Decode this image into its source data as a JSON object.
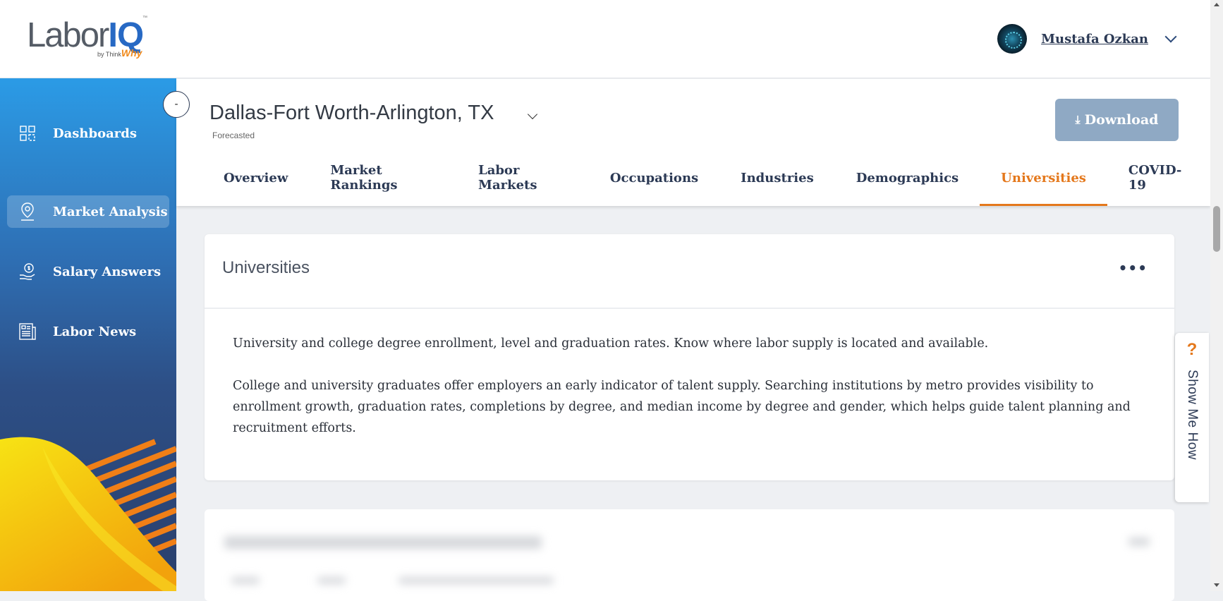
{
  "brand": {
    "logo_main": "Labor",
    "logo_iq": "IQ",
    "logo_by": "by Think",
    "logo_why": "Why",
    "logo_tm": "™"
  },
  "user": {
    "name": "Mustafa Ozkan"
  },
  "sidebar": {
    "collapse_label": "-",
    "items": [
      {
        "label": "Dashboards",
        "icon": "grid-icon",
        "active": false
      },
      {
        "label": "Market Analysis",
        "icon": "location-pin-icon",
        "active": true
      },
      {
        "label": "Salary Answers",
        "icon": "money-hand-icon",
        "active": false
      },
      {
        "label": "Labor News",
        "icon": "newspaper-icon",
        "active": false
      }
    ]
  },
  "header": {
    "location": "Dallas-Fort Worth-Arlington, TX",
    "subtitle": "Forecasted",
    "download_label": "Download",
    "tabs": [
      {
        "label": "Overview",
        "active": false
      },
      {
        "label": "Market Rankings",
        "active": false
      },
      {
        "label": "Labor Markets",
        "active": false
      },
      {
        "label": "Occupations",
        "active": false
      },
      {
        "label": "Industries",
        "active": false
      },
      {
        "label": "Demographics",
        "active": false
      },
      {
        "label": "Universities",
        "active": true
      },
      {
        "label": "COVID-19",
        "active": false
      }
    ]
  },
  "card": {
    "title": "Universities",
    "menu": "•••",
    "paragraph1": "University and college degree enrollment, level and graduation rates. Know where labor supply is located and available.",
    "paragraph2": "College and university graduates offer employers an early indicator of talent supply. Searching institutions by metro provides visibility to enrollment growth, graduation rates, completions by degree, and median income by degree and gender, which helps guide talent planning and recruitment efforts."
  },
  "show_me_how": {
    "icon": "?",
    "label": "Show Me How"
  },
  "colors": {
    "accent": "#e4781c",
    "navy": "#2c3a55",
    "download_bg": "#8fa9c4"
  }
}
